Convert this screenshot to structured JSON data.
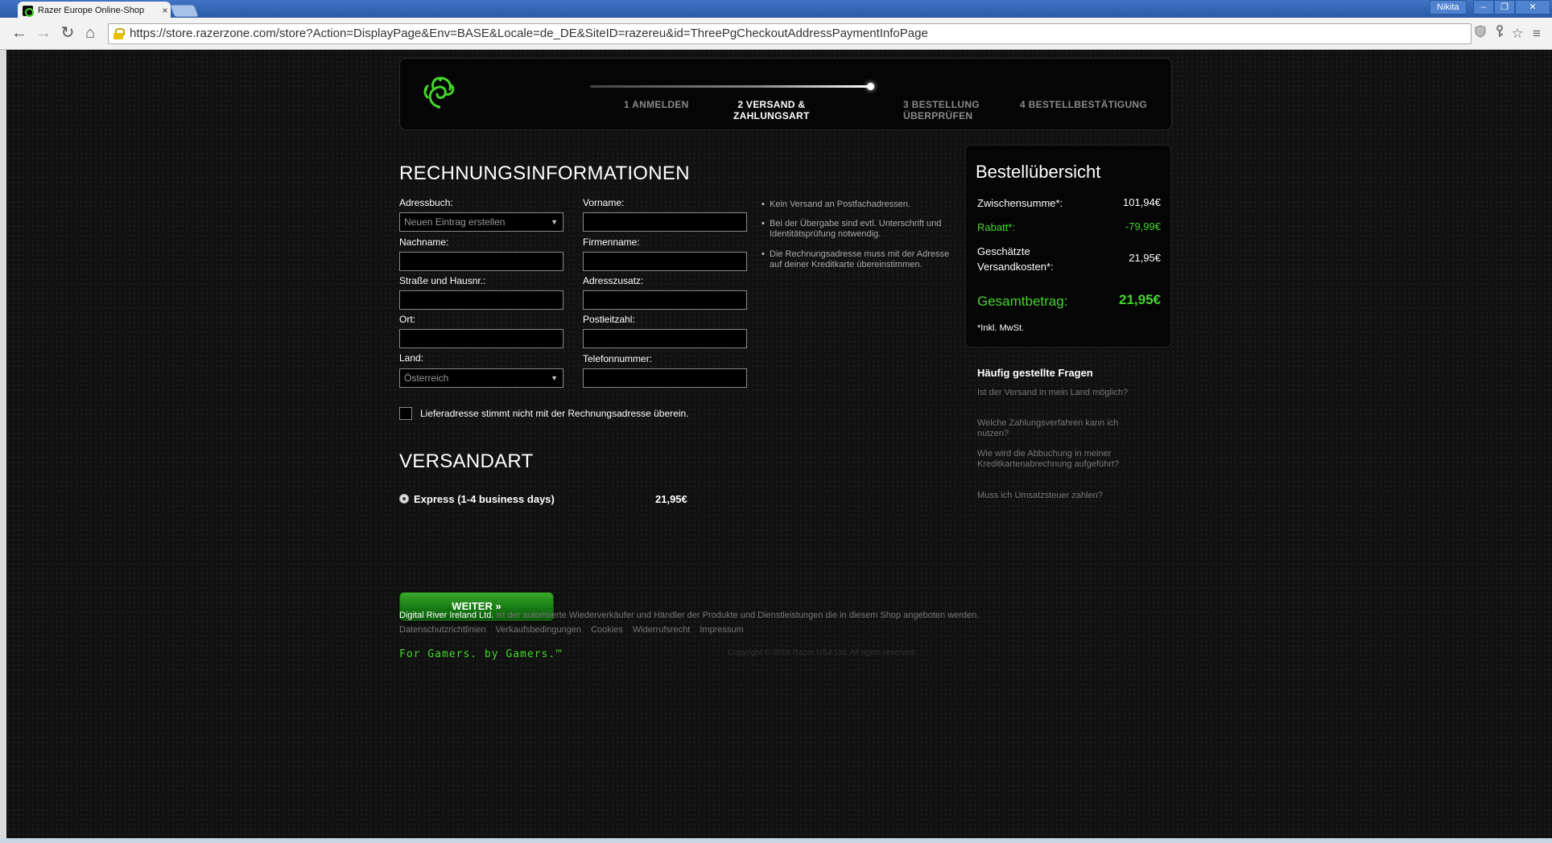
{
  "browser": {
    "tab_title": "Razer Europe Online-Shop",
    "tab_close": "×",
    "profile_name": "Nikita",
    "minimize": "–",
    "maximize": "❐",
    "close": "✕",
    "url": "https://store.razerzone.com/store?Action=DisplayPage&Env=BASE&Locale=de_DE&SiteID=razereu&id=ThreePgCheckoutAddressPaymentInfoPage",
    "back": "←",
    "forward": "→",
    "reload": "↻",
    "home": "⌂",
    "menu": "≡",
    "star": "☆"
  },
  "steps": [
    {
      "label": "1 ANMELDEN"
    },
    {
      "label": "2 VERSAND &\nZAHLUNGSART"
    },
    {
      "label": "3 BESTELLUNG\nÜBERPRÜFEN"
    },
    {
      "label": "4 BESTELLBESTÄTIGUNG"
    }
  ],
  "billing": {
    "title": "RECHNUNGSINFORMATIONEN",
    "address_book_label": "Adressbuch:",
    "address_book_value": "Neuen Eintrag erstellen",
    "firstname_label": "Vorname:",
    "lastname_label": "Nachname:",
    "company_label": "Firmenname:",
    "street_label": "Straße und Hausnr.:",
    "address2_label": "Adresszusatz:",
    "city_label": "Ort:",
    "zip_label": "Postleitzahl:",
    "country_label": "Land:",
    "country_value": "Österreich",
    "phone_label": "Telefonnummer:",
    "shipping_differs_label": "Lieferadresse stimmt nicht mit der Rechnungsadresse überein.",
    "notes": [
      "Kein Versand an Postfachadressen.",
      "Bei der Übergabe sind evtl. Unterschrift und Identitätsprüfung notwendig.",
      "Die Rechnungsadresse muss mit der Adresse auf deiner Kreditkarte übereinstimmen."
    ]
  },
  "shipping": {
    "title": "VERSANDART",
    "option_label": "Express (1-4 business days)",
    "option_price": "21,95€"
  },
  "weiter_button": "WEITER »",
  "summary": {
    "title": "Bestellübersicht",
    "subtotal_label": "Zwischensumme*:",
    "subtotal_value": "101,94€",
    "discount_label": "Rabatt*:",
    "discount_value": "-79,99€",
    "shipping_label": "Geschätzte Versandkosten*:",
    "shipping_value": "21,95€",
    "total_label": "Gesamtbetrag:",
    "total_value": "21,95€",
    "vat_note": "*Inkl. MwSt."
  },
  "faq": {
    "title": "Häufig gestellte Fragen",
    "links": [
      "Ist der Versand in mein Land möglich?",
      "Welche Zahlungsverfahren kann ich nutzen?",
      "Wie wird die Abbuchung in meiner Kreditkartenabrechnung aufgeführt?",
      "Muss ich Umsatzsteuer zahlen?"
    ]
  },
  "footer": {
    "company": "Digital River Ireland Ltd.",
    "company_text": " ist der autorisierte Wiederverkäufer und Händler der Produkte und Dienstleistungen die in diesem Shop angeboten werden.",
    "links": [
      "Datenschutzrichtlinien",
      "Verkaufsbedingungen",
      "Cookies",
      "Widerrufsrecht",
      "Impressum"
    ],
    "slogan": "For Gamers. by Gamers.™",
    "copyright": "Copyright © 2016 Razer USA Ltd. All rights reserved."
  },
  "colors": {
    "accent": "#44d62c",
    "button": "#177a14",
    "background": "#111111"
  }
}
